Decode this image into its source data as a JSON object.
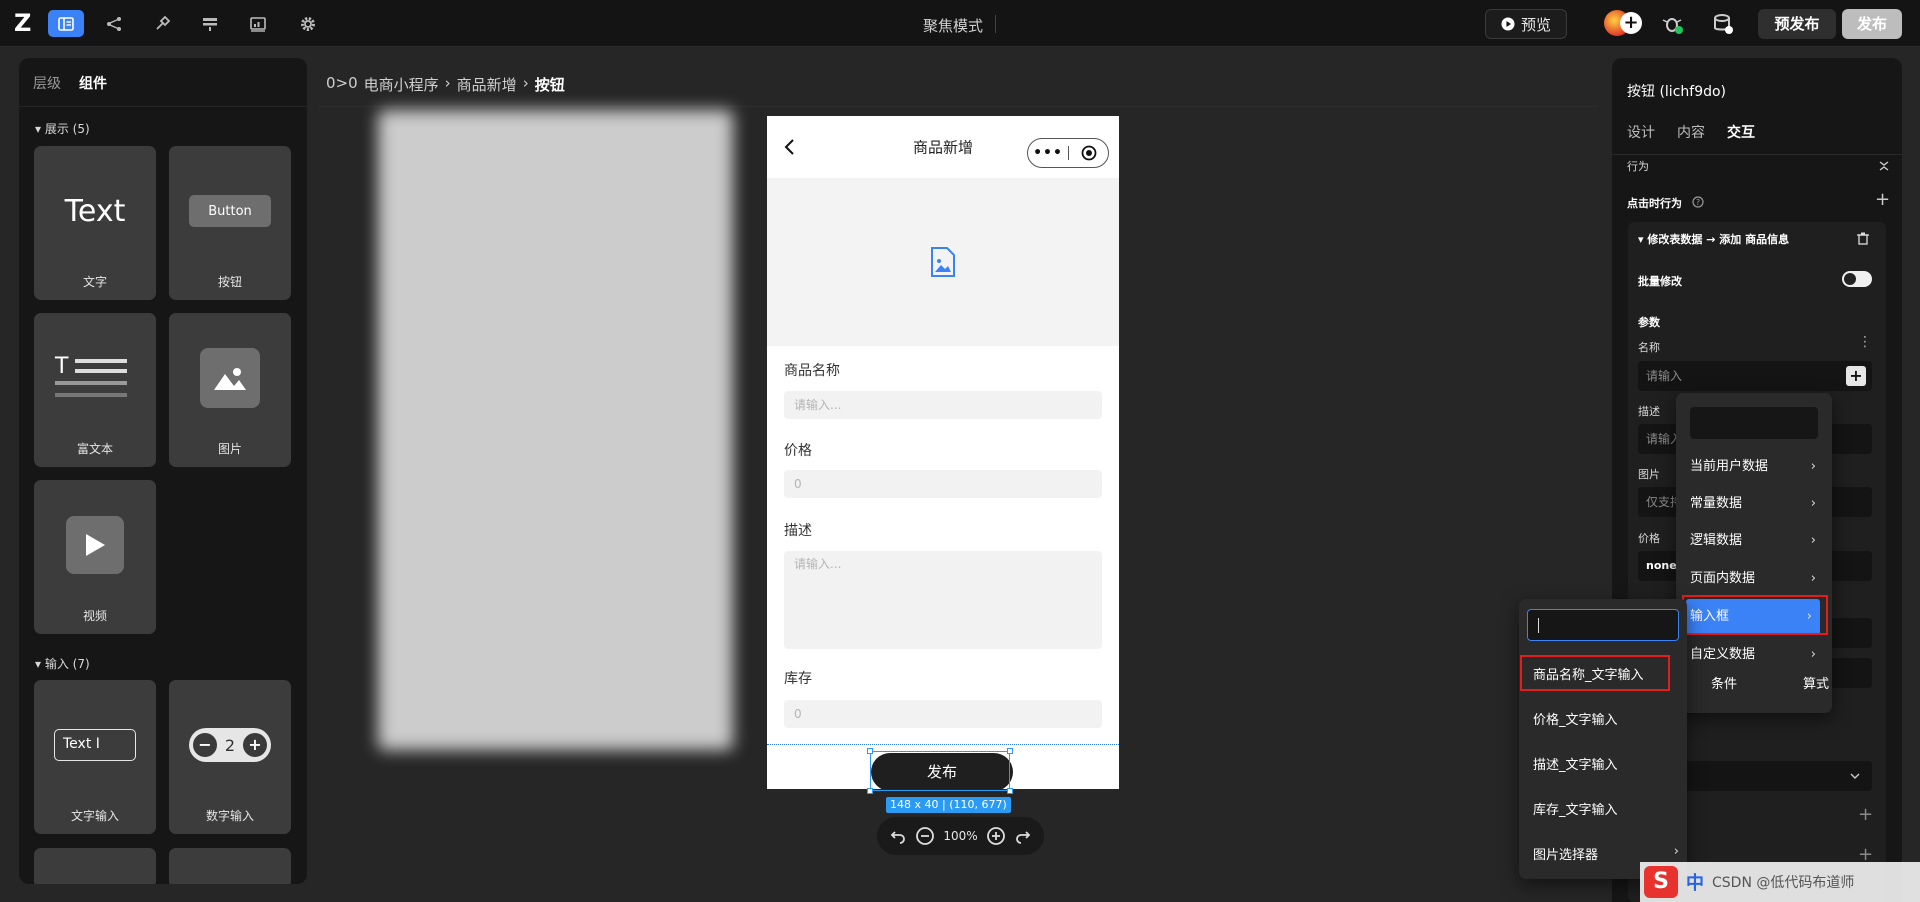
{
  "topbar": {
    "logo": "Z",
    "mode_title": "聚焦模式",
    "preview_label": "预览",
    "prepublish_label": "预发布",
    "publish_label": "发布",
    "accent": "#3b82f6"
  },
  "left_panel": {
    "tabs": [
      "层级",
      "组件"
    ],
    "sections": [
      {
        "title": "展示 (5)",
        "items": [
          "文字",
          "按钮",
          "富文本",
          "图片",
          "视频"
        ]
      },
      {
        "title": "输入 (7)",
        "items": [
          "文字输入",
          "数字输入"
        ]
      }
    ],
    "text_card_preview": "Text",
    "button_card_preview": "Button",
    "text_input_preview": "Text",
    "stepper_minus": "−",
    "stepper_value": "2",
    "stepper_plus": "+"
  },
  "breadcrumb": {
    "prefix": "0>0",
    "items": [
      "电商小程序",
      "商品新增",
      "按钮"
    ],
    "separator": "›"
  },
  "phone": {
    "title": "商品新增",
    "capsule_dots": "•••",
    "fields": [
      {
        "label": "商品名称",
        "placeholder": "请输入..."
      },
      {
        "label": "价格",
        "placeholder": "0"
      },
      {
        "label": "描述",
        "placeholder": "请输入..."
      },
      {
        "label": "库存",
        "placeholder": "0"
      }
    ],
    "submit_label": "发布",
    "selection_size": "148 x 40 | (110, 677)"
  },
  "zoom": {
    "value": "100%"
  },
  "right_panel": {
    "title": "按钮 (lichf9do)",
    "tabs": [
      "设计",
      "内容",
      "交互"
    ],
    "behavior_label": "行为",
    "click_label": "点击时行为",
    "action_title": "修改表数据 → 添加 商品信息",
    "batch_label": "批量修改",
    "params_label": "参数",
    "name_label": "名称",
    "name_placeholder": "请输入",
    "desc_label": "描述",
    "desc_placeholder": "请输入",
    "image_label": "图片",
    "image_placeholder": "仅支持",
    "price_label": "价格",
    "price_value": "none"
  },
  "data_menu": {
    "items": [
      "当前用户数据",
      "常量数据",
      "逻辑数据",
      "页面内数据",
      "输入框",
      "自定义数据"
    ],
    "highlighted": "输入框",
    "footer": [
      "条件",
      "算式"
    ]
  },
  "input_menu": {
    "items": [
      "商品名称_文字输入",
      "价格_文字输入",
      "描述_文字输入",
      "库存_文字输入",
      "图片选择器"
    ]
  },
  "tray": {
    "ime_cn": "中",
    "text": "CSDN @低代码布道师"
  }
}
